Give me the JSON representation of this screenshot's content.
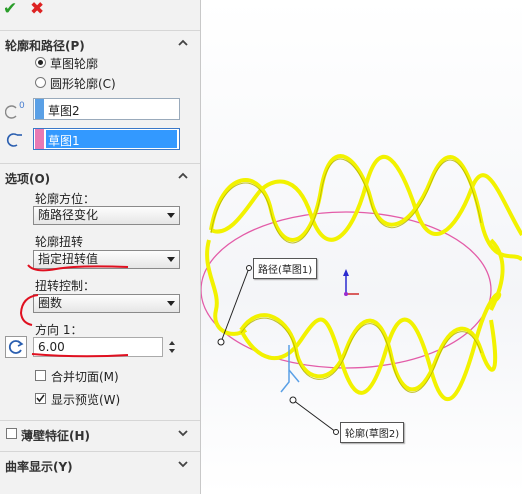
{
  "toolbar": {
    "ok_icon": "checkmark-icon",
    "cancel_icon": "cross-icon"
  },
  "profile_path": {
    "title": "轮廓和路径(P)",
    "radio_sketch": "草图轮廓",
    "radio_circle": "圆形轮廓(C)",
    "selected": "草图轮廓",
    "path_field": "草图2",
    "profile_field": "草图1",
    "path_color": "#5aa0e6",
    "profile_color": "#e87ab4"
  },
  "options": {
    "title": "选项(O)",
    "orientation_label": "轮廓方位：",
    "orientation_value": "随路径变化",
    "twist_label": "轮廓扭转",
    "twist_value": "指定扭转值",
    "twist_control_label": "扭转控制：",
    "twist_control_value": "圈数",
    "direction_label": "方向 1：",
    "direction_value": "6.00",
    "merge_faces_label": "合并切面(M)",
    "merge_faces_checked": false,
    "preview_label": "显示预览(W)",
    "preview_checked": true
  },
  "thin_feature": {
    "title": "薄壁特征(H)",
    "checked": false
  },
  "curvature": {
    "title": "曲率显示(Y)"
  },
  "viewport": {
    "path_callout": "路径(草图1)",
    "profile_callout": "轮廓(草图2)",
    "sweep_color": "#f2f200",
    "path_circle_color": "#e35ca8"
  }
}
